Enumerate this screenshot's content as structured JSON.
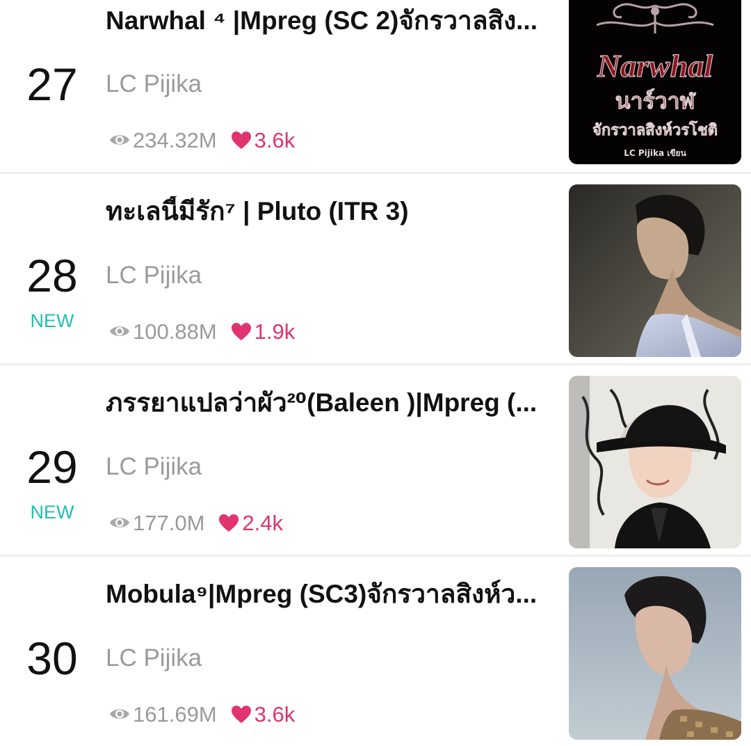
{
  "items": [
    {
      "rank": "27",
      "badge": "",
      "title": "Narwhal ⁴ |Mpreg (SC 2)จักรวาลสิง...",
      "author": "LC Pijika",
      "views": "234.32M",
      "likes": "3.6k",
      "cover_text": {
        "title_en": "Narwhal",
        "title_th": "นาร์วาฬ",
        "subtitle": "จักรวาลสิงห์วรโชติ",
        "byline": "LC Pijika เขียน"
      }
    },
    {
      "rank": "28",
      "badge": "NEW",
      "title": "ทะเลนี้มีรัก⁷ | Pluto  (ITR 3)",
      "author": "LC Pijika",
      "views": "100.88M",
      "likes": "1.9k"
    },
    {
      "rank": "29",
      "badge": "NEW",
      "title": "ภรรยาแปลว่าผัว²⁰(Baleen )|Mpreg (...",
      "author": "LC Pijika",
      "views": "177.0M",
      "likes": "2.4k"
    },
    {
      "rank": "30",
      "badge": "",
      "title": "Mobula⁹|Mpreg (SC3)จักรวาลสิงห์ว...",
      "author": "LC Pijika",
      "views": "161.69M",
      "likes": "3.6k"
    }
  ],
  "icons": {
    "views": "eye-icon",
    "likes": "heart-icon"
  },
  "colors": {
    "rank": "#111111",
    "new_badge": "#1fbfb3",
    "author": "#9a9a9a",
    "likes": "#e0336f",
    "divider": "#ededed"
  }
}
